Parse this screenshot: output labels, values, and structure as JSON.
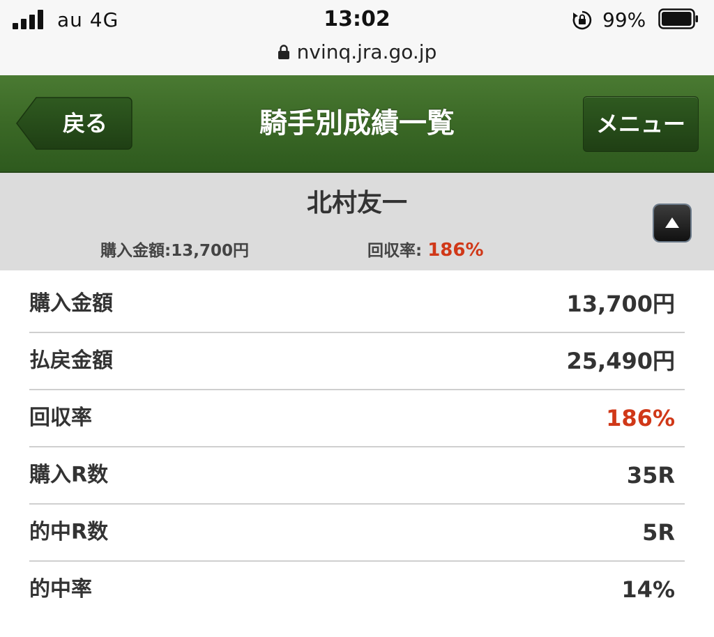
{
  "status_bar": {
    "carrier": "au  4G",
    "time": "13:02",
    "battery": "99%",
    "battery_level": 0.99,
    "url": "nvinq.jra.go.jp"
  },
  "header": {
    "back_label": "戻る",
    "title": "騎手別成績一覧",
    "menu_label": "メニュー"
  },
  "summary": {
    "jockey_name": "北村友一",
    "purchase_text": "購入金額:13,700円",
    "rate_label": "回収率:",
    "rate_value": "186%"
  },
  "rows": [
    {
      "label": "購入金額",
      "value": "13,700円"
    },
    {
      "label": "払戻金額",
      "value": "25,490円"
    },
    {
      "label": "回収率",
      "value": "186%"
    },
    {
      "label": "購入R数",
      "value": "35R"
    },
    {
      "label": "的中R数",
      "value": "5R"
    },
    {
      "label": "的中率",
      "value": "14%"
    }
  ],
  "colors": {
    "header_green": "#3c6a27",
    "accent_red": "#d03818",
    "summary_bg": "#dcdcdc"
  },
  "icons": {
    "signal": "signal-bars-icon",
    "rotation_lock": "rotation-lock-icon",
    "battery": "battery-icon",
    "padlock": "padlock-icon",
    "collapse": "triangle-up-icon"
  }
}
